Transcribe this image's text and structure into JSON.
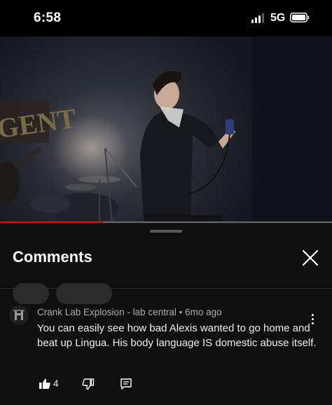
{
  "status_bar": {
    "time": "6:58",
    "network": "5G",
    "signal_icon": "signal-bars-icon",
    "battery_icon": "battery-icon"
  },
  "video": {
    "description_icon": "video-frame",
    "stage_text": "GENT",
    "progress_fraction": 0.31,
    "accent_color": "#ff0000"
  },
  "comments_panel": {
    "title": "Comments",
    "close_icon": "close-icon",
    "comments": [
      {
        "author": "Crank Lab Explosion - lab central",
        "separator": "•",
        "time_ago": "6mo ago",
        "text": "You can easily see how bad Alexis wanted to go home and beat up Lingua. His body language IS domestic abuse itself.",
        "likes": "4",
        "like_icon": "thumbs-up-icon",
        "dislike_icon": "thumbs-down-icon",
        "reply_icon": "reply-icon",
        "menu_icon": "more-vertical-icon"
      }
    ]
  }
}
